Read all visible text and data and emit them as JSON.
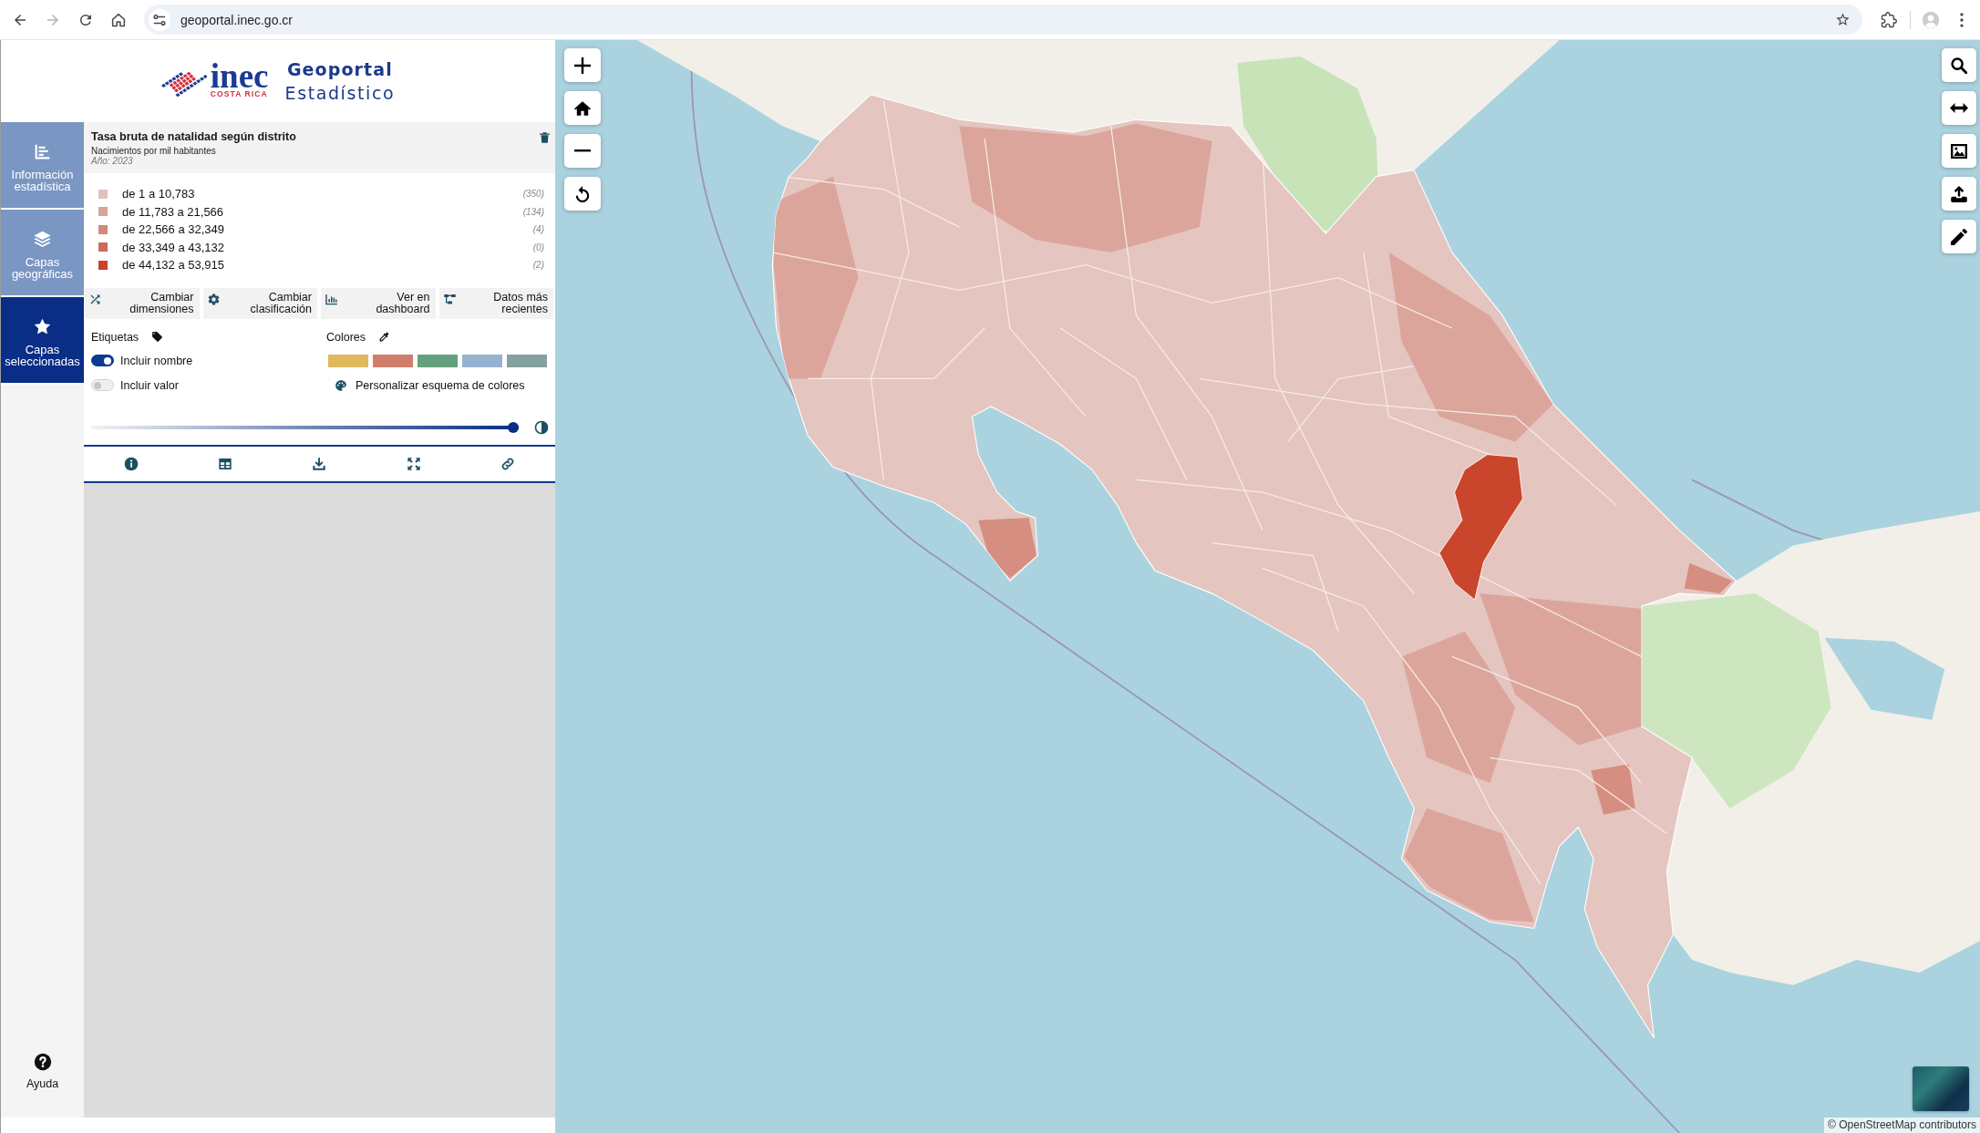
{
  "browser": {
    "url": "geoportal.inec.go.cr"
  },
  "header": {
    "logo_word": "inec",
    "logo_country": "COSTA RICA",
    "title": "Geoportal",
    "subtitle": "Estadístico"
  },
  "sidebar": {
    "items": [
      {
        "label": "Información estadística",
        "selected": false
      },
      {
        "label": "Capas geográficas",
        "selected": false
      },
      {
        "label": "Capas seleccionadas",
        "selected": true
      }
    ],
    "help": "Ayuda"
  },
  "layer": {
    "title": "Tasa bruta de natalidad según distrito",
    "unit": "Nacimientos por mil habitantes",
    "year": "Año: 2023",
    "legend": [
      {
        "label": "de 1 a 10,783",
        "count": "(350)",
        "color": "#dcc1bd"
      },
      {
        "label": "de 11,783 a 21,566",
        "count": "(134)",
        "color": "#d9a59a"
      },
      {
        "label": "de 22,566 a 32,349",
        "count": "(4)",
        "color": "#d4897b"
      },
      {
        "label": "de 33,349 a 43,132",
        "count": "(0)",
        "color": "#cd6b57"
      },
      {
        "label": "de 44,132 a 53,915",
        "count": "(2)",
        "color": "#c8432a"
      }
    ],
    "actions": [
      {
        "label": "Cambiar dimensiones"
      },
      {
        "label": "Cambiar clasificación"
      },
      {
        "label": "Ver en dashboard"
      },
      {
        "label": "Datos más recientes"
      }
    ]
  },
  "labels_section": {
    "title": "Etiquetas",
    "toggles": [
      {
        "label": "Incluir nombre",
        "on": true
      },
      {
        "label": "Incluir valor",
        "on": false
      }
    ]
  },
  "colors_section": {
    "title": "Colores",
    "palette": [
      {
        "color": "#e0b95f"
      },
      {
        "color": "#d07d6c"
      },
      {
        "color": "#65a07e"
      },
      {
        "color": "#94b3d0"
      },
      {
        "color": "#85a19f"
      }
    ],
    "customize": "Personalizar esquema de colores"
  },
  "opacity": {
    "level": 1
  },
  "map": {
    "attribution": "© OpenStreetMap contributors"
  }
}
